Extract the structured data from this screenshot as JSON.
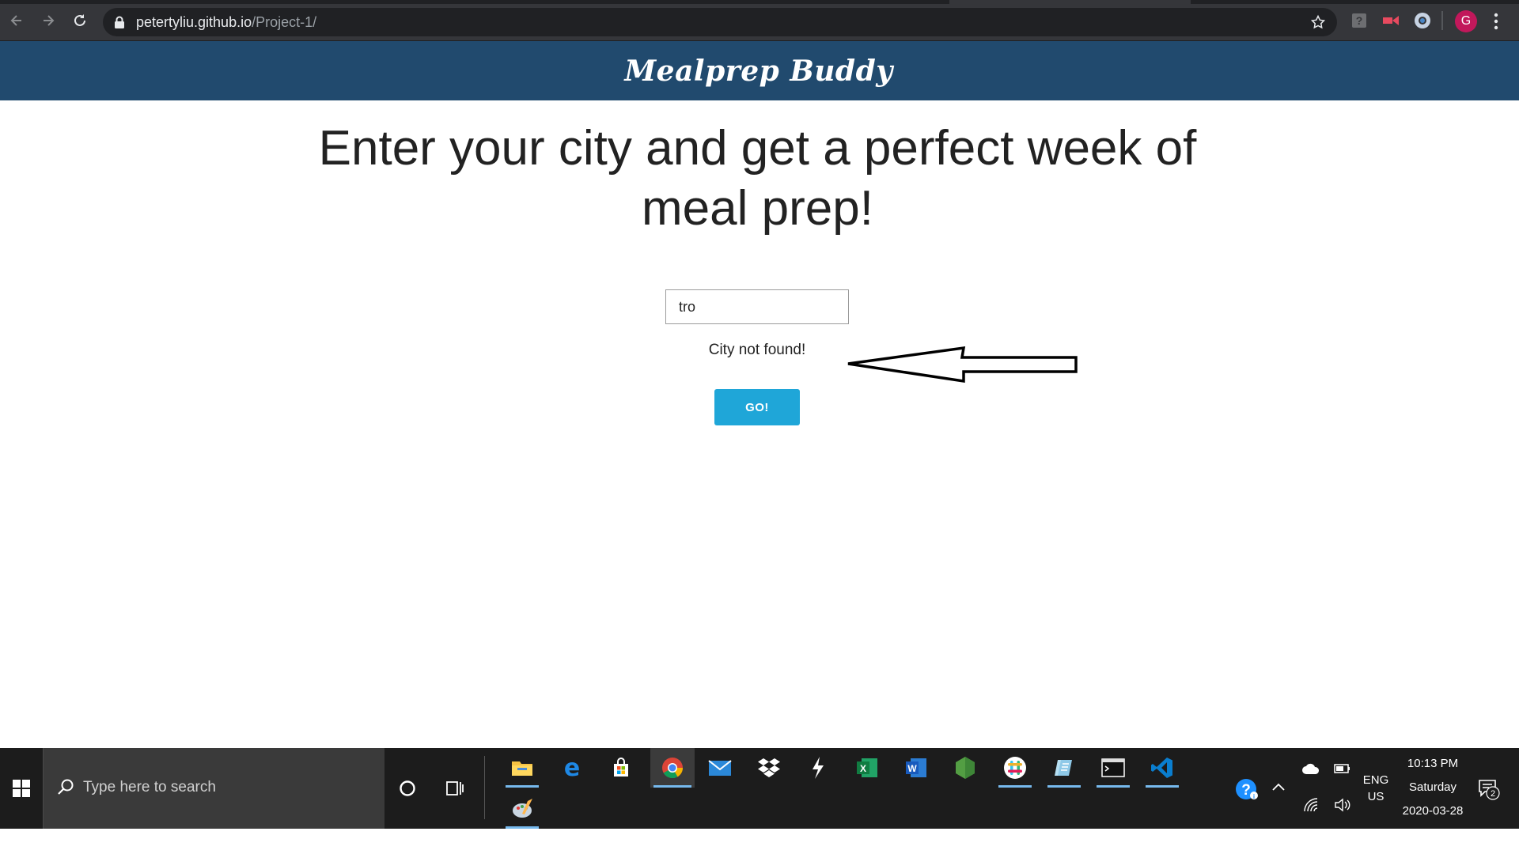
{
  "browser": {
    "url_host": "petertyliu.github.io",
    "url_path": "/Project-1/",
    "profile_initial": "G"
  },
  "site": {
    "brand": "Mealprep Buddy",
    "headline": "Enter your city and get a perfect week of meal prep!",
    "city_input_value": "tro",
    "error_message": "City not found!",
    "go_label": "GO!"
  },
  "taskbar": {
    "search_placeholder": "Type here to search",
    "apps": [
      "File Explorer",
      "Microsoft Edge",
      "Microsoft Store",
      "Google Chrome",
      "Mail",
      "Dropbox",
      "Git Bash",
      "Excel",
      "Word",
      "Node.js",
      "Slack",
      "Notepad",
      "Terminal",
      "Visual Studio Code",
      "Paint"
    ],
    "lang_line1": "ENG",
    "lang_line2": "US",
    "time": "10:13 PM",
    "day": "Saturday",
    "date": "2020-03-28",
    "notification_count": "2"
  },
  "colors": {
    "site_header": "#214a6e",
    "go_button": "#1fa6d8",
    "chrome_bg": "#35363a",
    "taskbar_bg": "#1c1c1c"
  }
}
